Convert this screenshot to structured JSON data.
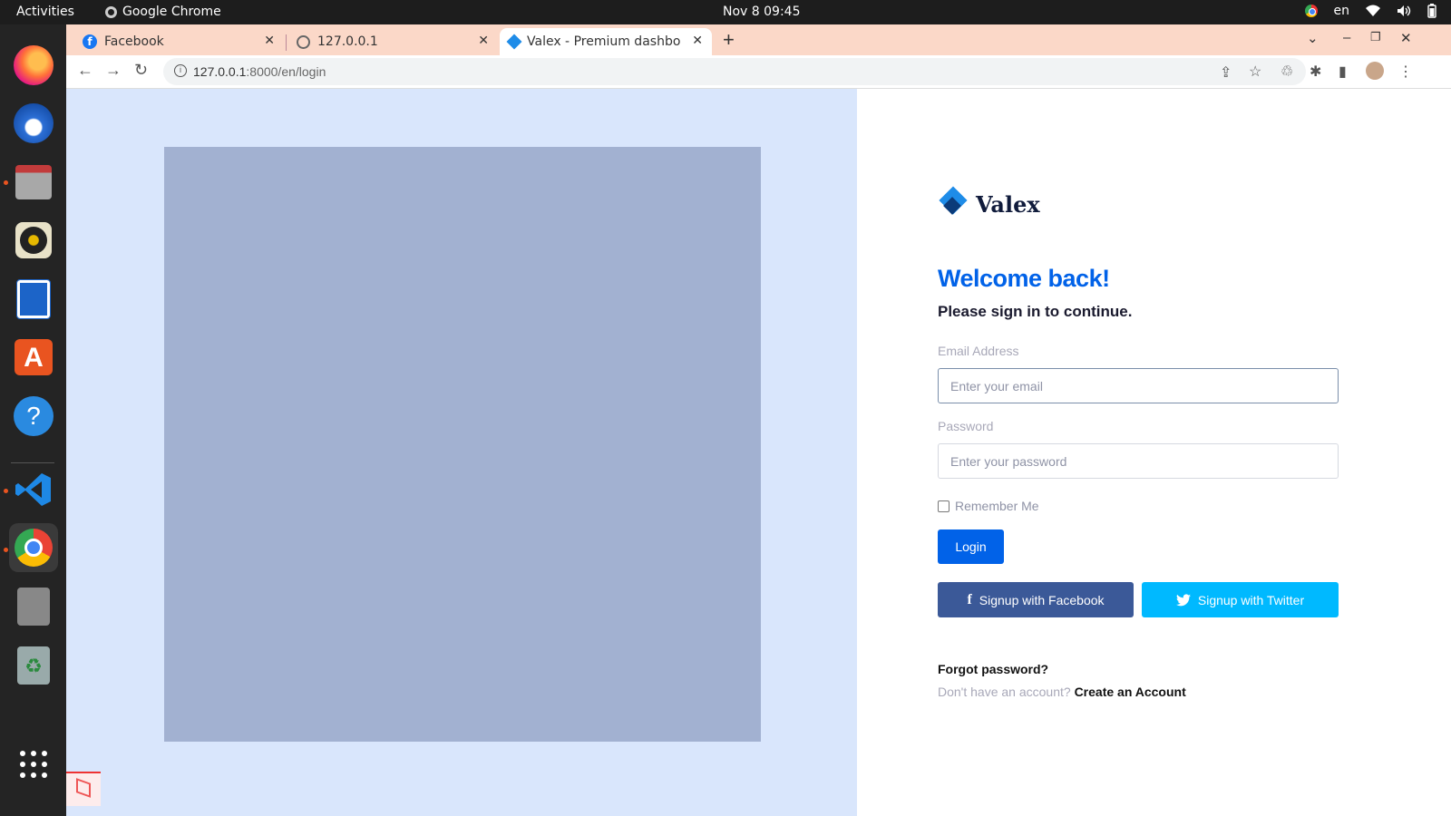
{
  "system_bar": {
    "activities": "Activities",
    "app_name": "Google Chrome",
    "clock": "Nov 8  09:45",
    "language": "en"
  },
  "dock": {
    "items": [
      {
        "name": "firefox-icon"
      },
      {
        "name": "thunderbird-icon"
      },
      {
        "name": "files-icon"
      },
      {
        "name": "rhythmbox-icon"
      },
      {
        "name": "writer-icon"
      },
      {
        "name": "app-center-icon"
      },
      {
        "name": "help-icon"
      },
      {
        "name": "vscode-icon"
      },
      {
        "name": "chrome-icon"
      },
      {
        "name": "text-editor-icon"
      },
      {
        "name": "trash-icon"
      },
      {
        "name": "app-grid-icon"
      }
    ]
  },
  "browser": {
    "tabs": [
      {
        "title": "Facebook"
      },
      {
        "title": "127.0.0.1"
      },
      {
        "title": "Valex - Premium dashboard"
      }
    ],
    "url_host": "127.0.0.1",
    "url_path": ":8000/en/login"
  },
  "login": {
    "brand": "Valex",
    "welcome": "Welcome back!",
    "subtitle": "Please sign in to continue.",
    "email_label": "Email Address",
    "email_placeholder": "Enter your email",
    "email_value": "",
    "password_label": "Password",
    "password_placeholder": "Enter your password",
    "password_value": "",
    "remember_label": "Remember Me",
    "remember_checked": false,
    "login_button": "Login",
    "facebook_button": "Signup with Facebook",
    "twitter_button": "Signup with Twitter",
    "forgot": "Forgot password?",
    "no_account": "Don't have an account?",
    "create_account": "Create an Account"
  },
  "colors": {
    "primary": "#0162e8",
    "facebook": "#3b5998",
    "twitter": "#00b9ff",
    "left_pane": "#d9e6fc",
    "hero_placeholder": "#a2b1d1"
  }
}
